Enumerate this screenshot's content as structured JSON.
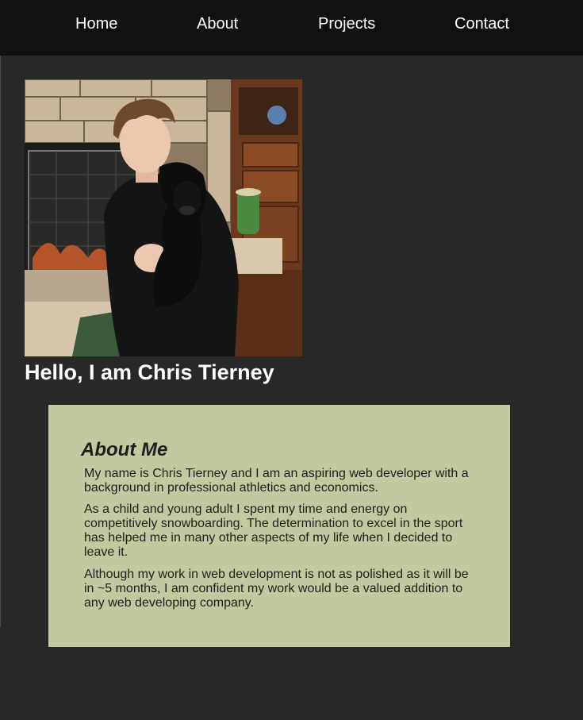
{
  "nav": {
    "items": [
      {
        "label": "Home"
      },
      {
        "label": "About"
      },
      {
        "label": "Projects"
      },
      {
        "label": "Contact"
      }
    ]
  },
  "profile": {
    "headline": "Hello, I am Chris Tierney"
  },
  "about": {
    "title": "About Me",
    "paragraphs": [
      "My name is Chris Tierney and I am an aspiring web developer with a background in professional athletics and economics.",
      "As a child and young adult I spent my time and energy on competitively snowboarding. The determination to excel in the sport has helped me in many other aspects of my life when I decided to leave it.",
      "Although my work in web development is not as polished as it will be in ~5 months, I am confident my work would be a valued addition to any web developing company."
    ]
  },
  "colors": {
    "page_background": "#292829",
    "nav_background": "#111111",
    "card_background": "#c4c8a0",
    "text_light": "#ffffff",
    "text_dark": "#1e1e1e"
  }
}
